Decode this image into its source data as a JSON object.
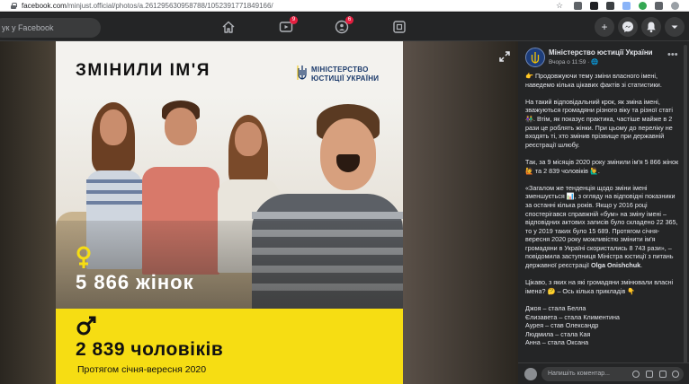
{
  "browser": {
    "url_host": "facebook.com",
    "url_path": "/minjust.official/photos/a.261295630958788/1052391771849166/"
  },
  "topbar": {
    "search_placeholder": "ук у Facebook",
    "watch_badge": "9",
    "groups_badge": "6"
  },
  "photo": {
    "title": "ЗМІНИЛИ ІМ'Я",
    "ministry_line1": "МІНІСТЕРСТВО",
    "ministry_line2": "ЮСТИЦІЇ УКРАЇНИ",
    "women_count": "5 866 жінок",
    "men_count": "2 839 чоловіків",
    "period": "Протягом січня-вересня 2020"
  },
  "post": {
    "page_name": "Міністерство юстиції України",
    "meta": "Вчора о 11:59 · 🌐",
    "p1": "👉 Продовжуючи тему зміни власного імені, наведемо кілька цікавих фактів зі статистики.",
    "p2": "На такий відповідальний крок, як зміна імені, зважуються громадяни різного віку та різної статі 👫. Втім, як показує практика, частіше майже в 2 рази це роблять жінки. При цьому до переліку не входять ті, хто змінив прізвище при державній реєстрації шлюбу.",
    "p3": "Так, за 9 місяців 2020 року змінили ім'я 5 866 жінок🙋 та 2 839 чоловіків 🙋‍♂️.",
    "p4a": "«Загалом же тенденція щодо зміни імені зменшується 📊, з огляду на відповідні показники за останні кілька років. Якщо у 2016 році спостерігався справжній «бум» на зміну імені – відповідних актових записів було складено 22 365, то у 2019 таких було 15 689. Протягом січня-вересня 2020 року можливістю змінити ім'я громадяни в Україні скористались 8 743 рази», – повідомила заступниця Міністра юстиції з питань державної реєстрації ",
    "p4_name": "Olga Onishchuk",
    "p4b": ".",
    "p5": "Цікаво, з яких на які громадяни змінювали власні імена? 🤔 – Ось кілька прикладів 👇",
    "examples": [
      "Джоя – стала Белла",
      "Єлизавета – стала Климентина",
      "Аурея – став Олександр",
      "Людмила – стала Кая",
      "Анна – стала Оксана"
    ],
    "comment_placeholder": "Напишіть коментар..."
  },
  "colors": {
    "accent_yellow": "#f6dd13",
    "fb_dark": "#242526",
    "ministry_blue": "#1b3a6b"
  }
}
